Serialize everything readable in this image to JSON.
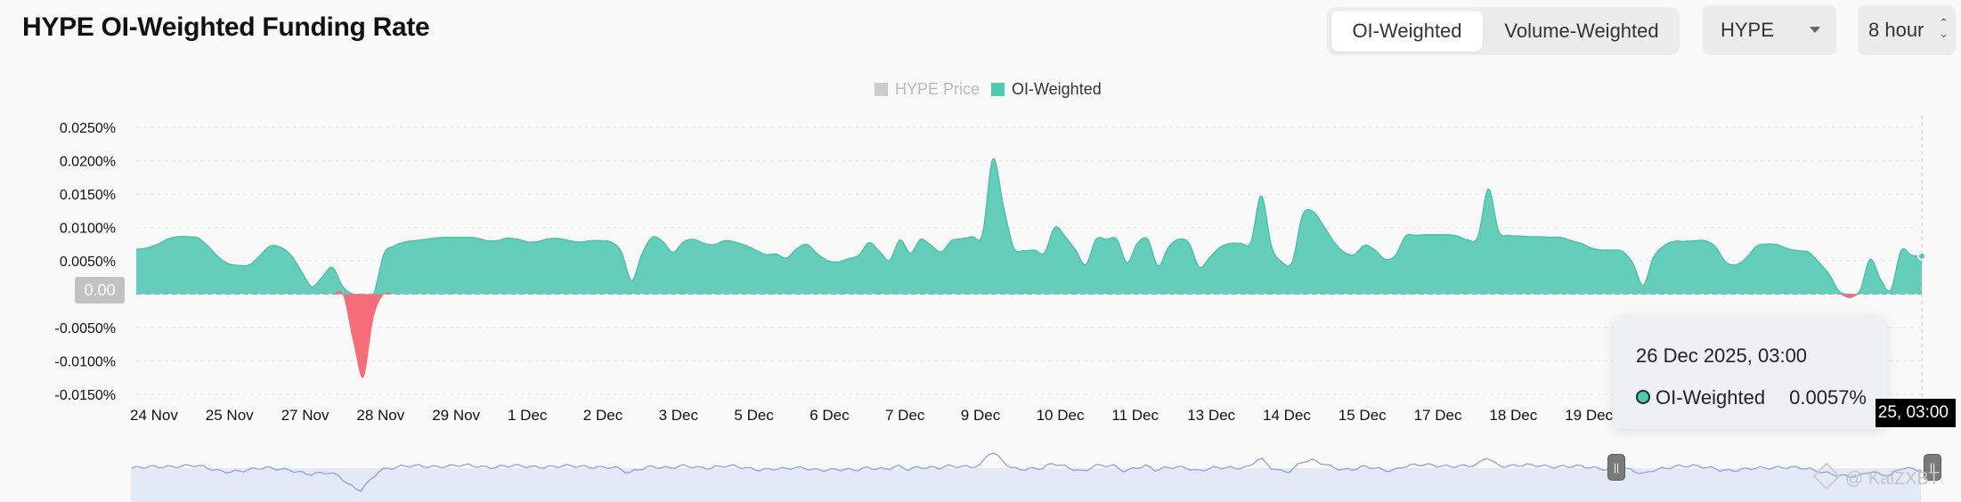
{
  "header": {
    "title": "HYPE OI-Weighted Funding Rate"
  },
  "controls": {
    "weighting_tabs": [
      {
        "label": "OI-Weighted",
        "active": true
      },
      {
        "label": "Volume-Weighted",
        "active": false
      }
    ],
    "asset_select": {
      "value": "HYPE"
    },
    "interval_select": {
      "value": "8 hour"
    }
  },
  "legend": [
    {
      "label": "HYPE Price",
      "color": "#cccccc",
      "enabled": false
    },
    {
      "label": "OI-Weighted",
      "color": "#4dcbb0",
      "enabled": true
    }
  ],
  "tooltip": {
    "date": "26 Dec 2025, 03:00",
    "series": "OI-Weighted",
    "value": "0.0057%"
  },
  "crosshair": {
    "x_label": "25, 03:00",
    "y_label": "0.00"
  },
  "watermark": "@ KaiZXBT",
  "colors": {
    "positive": "#64ceba",
    "negative": "#f46d78",
    "navigator_line": "#8ea2de"
  },
  "chart_data": {
    "type": "area",
    "title": "HYPE OI-Weighted Funding Rate",
    "xlabel": "",
    "ylabel": "",
    "y_ticks": [
      "0.0250%",
      "0.0200%",
      "0.0150%",
      "0.0100%",
      "0.0050%",
      "0.00",
      "-0.0050%",
      "-0.0100%",
      "-0.0150%"
    ],
    "x_ticks": [
      "24 Nov",
      "25 Nov",
      "27 Nov",
      "28 Nov",
      "29 Nov",
      "1 Dec",
      "2 Dec",
      "3 Dec",
      "5 Dec",
      "6 Dec",
      "7 Dec",
      "9 Dec",
      "10 Dec",
      "11 Dec",
      "13 Dec",
      "14 Dec",
      "15 Dec",
      "17 Dec",
      "18 Dec",
      "19 Dec"
    ],
    "ylim": [
      -0.015,
      0.025
    ],
    "grid": true,
    "legend_position": "top-center",
    "series": [
      {
        "name": "OI-Weighted",
        "unit": "%",
        "values": [
          0.0067,
          0.0069,
          0.0074,
          0.0082,
          0.0086,
          0.0086,
          0.0084,
          0.0071,
          0.0055,
          0.0045,
          0.0043,
          0.0044,
          0.0058,
          0.0072,
          0.007,
          0.0058,
          0.0034,
          0.0011,
          0.0025,
          0.004,
          0.0011,
          -0.007,
          -0.0125,
          -0.0035,
          0.006,
          0.0072,
          0.0078,
          0.008,
          0.0082,
          0.0084,
          0.0085,
          0.0085,
          0.0085,
          0.0084,
          0.008,
          0.008,
          0.0084,
          0.0082,
          0.0078,
          0.0079,
          0.0083,
          0.0083,
          0.008,
          0.0078,
          0.008,
          0.008,
          0.0078,
          0.0063,
          0.002,
          0.006,
          0.0085,
          0.0079,
          0.0062,
          0.0078,
          0.0082,
          0.0076,
          0.0074,
          0.008,
          0.0078,
          0.0073,
          0.0066,
          0.0059,
          0.006,
          0.0054,
          0.0068,
          0.0074,
          0.006,
          0.005,
          0.0048,
          0.0053,
          0.0058,
          0.0077,
          0.0064,
          0.0051,
          0.0081,
          0.0061,
          0.0082,
          0.0073,
          0.0063,
          0.008,
          0.0083,
          0.0086,
          0.009,
          0.0202,
          0.0133,
          0.007,
          0.0065,
          0.0066,
          0.0062,
          0.01,
          0.0086,
          0.0066,
          0.0044,
          0.0082,
          0.0082,
          0.0082,
          0.0047,
          0.0076,
          0.0082,
          0.0042,
          0.007,
          0.0082,
          0.0076,
          0.004,
          0.0055,
          0.007,
          0.0076,
          0.0076,
          0.0078,
          0.0147,
          0.0071,
          0.0048,
          0.0048,
          0.0118,
          0.0124,
          0.0103,
          0.0079,
          0.0063,
          0.0059,
          0.0073,
          0.0066,
          0.0052,
          0.0058,
          0.0087,
          0.0088,
          0.0089,
          0.0089,
          0.0089,
          0.0087,
          0.0081,
          0.0086,
          0.0157,
          0.0094,
          0.0088,
          0.0087,
          0.0086,
          0.0086,
          0.0085,
          0.0085,
          0.008,
          0.0076,
          0.0069,
          0.0066,
          0.0066,
          0.0064,
          0.0046,
          0.0013,
          0.0055,
          0.0072,
          0.0079,
          0.0079,
          0.008,
          0.008,
          0.0071,
          0.0048,
          0.0044,
          0.0054,
          0.0072,
          0.0075,
          0.0074,
          0.0068,
          0.0065,
          0.0063,
          0.0048,
          0.003,
          0.0004,
          -0.0006,
          0.0005,
          0.0052,
          0.0022,
          0.0006,
          0.0065,
          0.0058,
          0.0057
        ]
      }
    ]
  }
}
